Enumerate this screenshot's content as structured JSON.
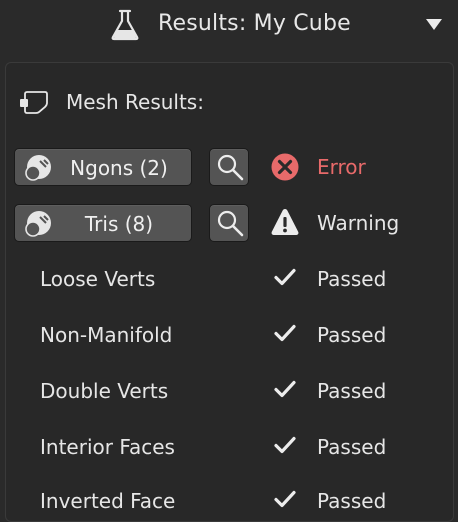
{
  "header": {
    "title": "Results: My Cube",
    "flask_icon": "flask-icon",
    "dropdown_icon": "triangle-down-icon"
  },
  "panel": {
    "section_label": "Mesh Results:",
    "section_icon": "mesh-object-icon",
    "issue_rows": [
      {
        "button_label": "Ngons (2)",
        "status": "Error",
        "status_icon": "error-x-icon"
      },
      {
        "button_label": "Tris (8)",
        "status": "Warning",
        "status_icon": "warning-triangle-icon"
      }
    ],
    "checks": [
      {
        "label": "Loose Verts",
        "status": "Passed"
      },
      {
        "label": "Non-Manifold",
        "status": "Passed"
      },
      {
        "label": "Double Verts",
        "status": "Passed"
      },
      {
        "label": "Interior Faces",
        "status": "Passed"
      },
      {
        "label": "Inverted Face",
        "status": "Passed"
      }
    ]
  },
  "colors": {
    "background": "#2a2a2a",
    "button": "#545454",
    "error": "#e86a6a",
    "text": "#e6e6e6"
  }
}
